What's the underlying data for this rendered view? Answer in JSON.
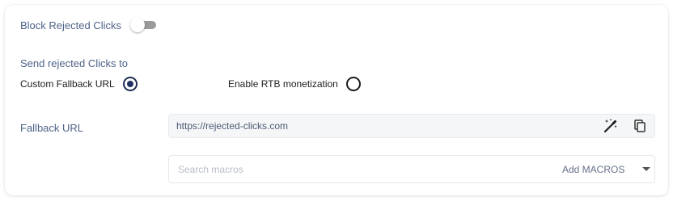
{
  "block_rejected": {
    "label": "Block Rejected Clicks",
    "toggle_on": false
  },
  "send_to": {
    "label": "Send rejected Clicks to",
    "options": [
      {
        "label": "Custom Fallback URL",
        "selected": true
      },
      {
        "label": "Enable RTB monetization",
        "selected": false
      }
    ]
  },
  "fallback": {
    "label": "Fallback URL",
    "url_value": "https://rejected-clicks.com",
    "icons": [
      "magic-wand-icon",
      "copy-icon"
    ]
  },
  "macros": {
    "placeholder": "Search macros",
    "add_label": "Add MACROS"
  },
  "colors": {
    "label": "#4e6388",
    "radio_selected": "#1f3161",
    "toggle_track_off": "#9a9a9a",
    "field_bg": "#f5f6f8"
  }
}
